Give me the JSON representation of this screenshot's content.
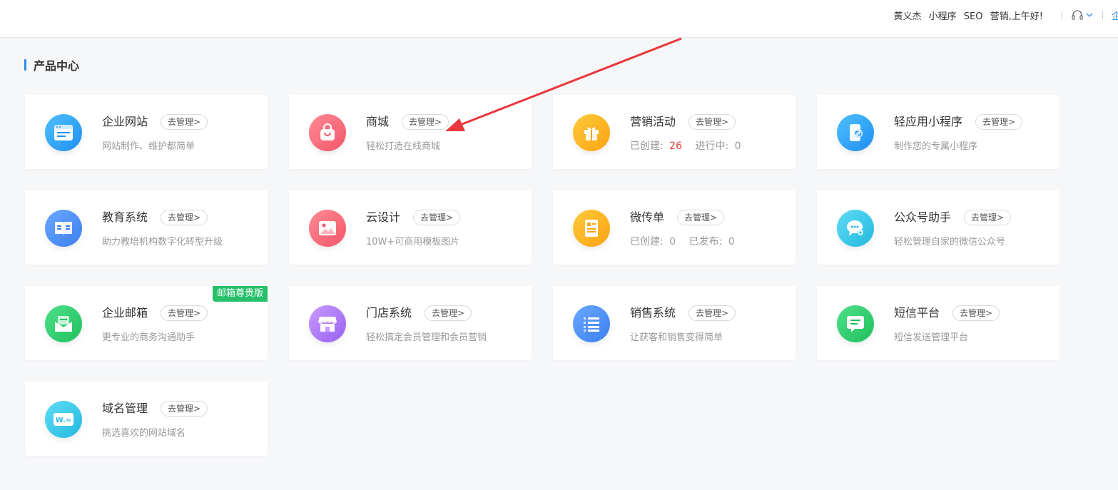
{
  "header": {
    "user_name": "黄义杰",
    "mini_program": "小程序",
    "seo": "SEO",
    "greeting": "营销,上午好!",
    "enterprise_link": "企"
  },
  "section": {
    "title": "产品中心"
  },
  "cards": [
    {
      "name": "企业网站",
      "manage": "去管理>",
      "desc": "网站制作、维护都简单",
      "icon": "website-icon",
      "color": "#2ea2f8"
    },
    {
      "name": "商城",
      "manage": "去管理>",
      "desc": "轻松打造在线商城",
      "icon": "shopping-bag-icon",
      "color": "#fb6b78"
    },
    {
      "name": "营销活动",
      "manage": "去管理>",
      "stats": {
        "created_label": "已创建:",
        "created_value": "26",
        "running_label": "进行中:",
        "running_value": "0"
      },
      "icon": "gift-icon",
      "color": "#fdb21e"
    },
    {
      "name": "轻应用小程序",
      "manage": "去管理>",
      "desc": "制作您的专属小程序",
      "icon": "mini-program-icon",
      "color": "#2ea2f8"
    },
    {
      "name": "教育系统",
      "manage": "去管理>",
      "desc": "助力教培机构数字化转型升级",
      "icon": "book-icon",
      "color": "#3b8ef5"
    },
    {
      "name": "云设计",
      "manage": "去管理>",
      "desc": "10W+可商用模板图片",
      "icon": "image-icon",
      "color": "#fb6b78"
    },
    {
      "name": "微传单",
      "manage": "去管理>",
      "stats": {
        "created_label": "已创建:",
        "created_value": "0",
        "running_label": "已发布:",
        "running_value": "0"
      },
      "icon": "flyer-icon",
      "color": "#fdb21e"
    },
    {
      "name": "公众号助手",
      "manage": "去管理>",
      "desc": "轻松管理自家的微信公众号",
      "icon": "chat-gear-icon",
      "color": "#2fc6ea"
    },
    {
      "name": "企业邮箱",
      "manage": "去管理>",
      "desc": "更专业的商务沟通助手",
      "icon": "mail-icon",
      "color": "#2ccb69",
      "badge": "邮箱尊贵版"
    },
    {
      "name": "门店系统",
      "manage": "去管理>",
      "desc": "轻松搞定会员管理和会员营销",
      "icon": "store-icon",
      "color": "#b27af4"
    },
    {
      "name": "销售系统",
      "manage": "去管理>",
      "desc": "让获客和销售变得简单",
      "icon": "list-icon",
      "color": "#3b8ef5"
    },
    {
      "name": "短信平台",
      "manage": "去管理>",
      "desc": "短信发送管理平台",
      "icon": "message-icon",
      "color": "#2ccb69"
    },
    {
      "name": "域名管理",
      "manage": "去管理>",
      "desc": "挑选喜欢的网站域名",
      "icon": "domain-icon",
      "color": "#2fc6ea"
    }
  ]
}
